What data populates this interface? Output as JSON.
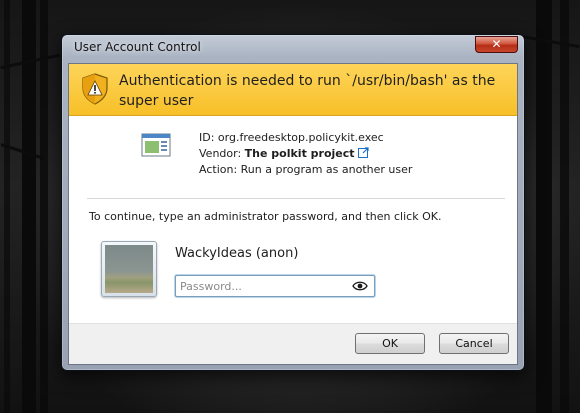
{
  "window": {
    "title": "User Account Control",
    "close_label": "✕"
  },
  "banner": {
    "message": "Authentication is needed to run `/usr/bin/bash' as the super user",
    "icon": "shield-warning-icon"
  },
  "details": {
    "icon": "application-icon",
    "id_line": "ID: org.freedesktop.policykit.exec",
    "vendor_prefix": "Vendor: ",
    "vendor_name": "The polkit project",
    "action_line": "Action: Run a program as another user"
  },
  "instruction": "To continue, type an administrator password, and then click OK.",
  "user": {
    "name": "WackyIdeas (anon)",
    "avatar": "user-avatar"
  },
  "password": {
    "value": "",
    "placeholder": "Password...",
    "reveal_icon": "eye-icon"
  },
  "buttons": {
    "ok": "OK",
    "cancel": "Cancel"
  },
  "colors": {
    "banner": "#f8c028",
    "close_button": "#c9462c",
    "link_icon": "#1a6fc8"
  }
}
